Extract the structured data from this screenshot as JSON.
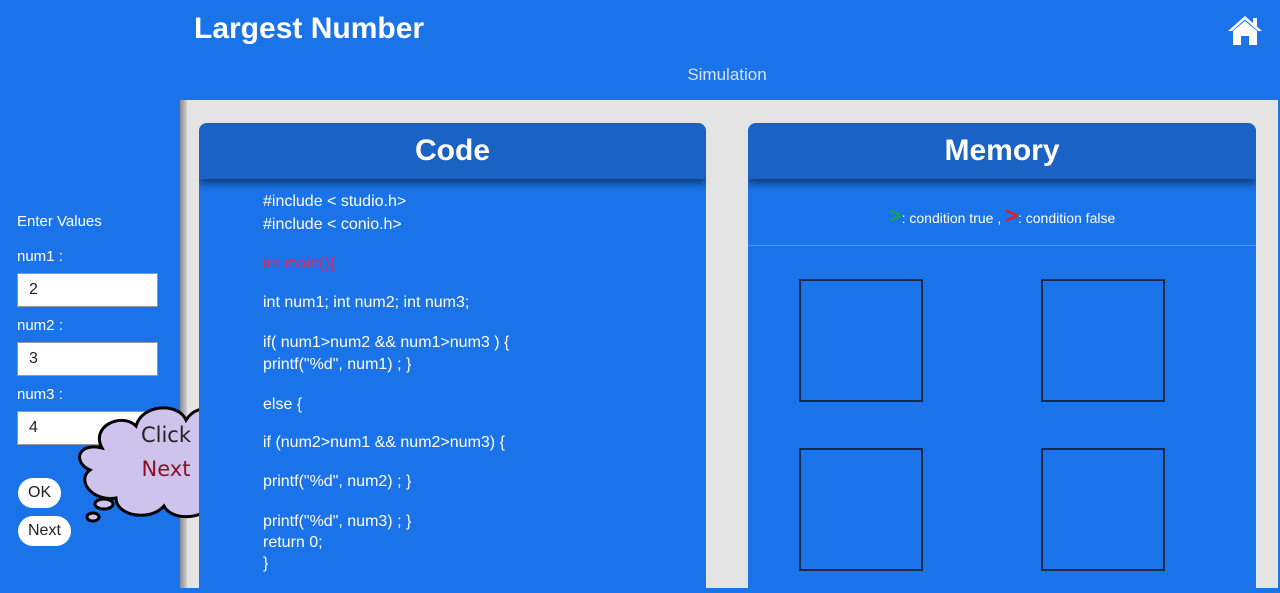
{
  "header": {
    "title": "Largest Number",
    "subtitle": "Simulation",
    "home_icon": "home-icon"
  },
  "sidebar": {
    "heading": "Enter Values",
    "num1_label": "num1 :",
    "num1_value": "2",
    "num2_label": "num2 :",
    "num2_value": "3",
    "num3_label": "num3 :",
    "num3_value": "4",
    "ok_label": "OK",
    "next_label": "Next",
    "hint_line1": "Click",
    "hint_line2": "Next"
  },
  "code_panel": {
    "title": "Code",
    "lines": [
      "#include < studio.h>",
      "#include < conio.h>",
      "int main(){",
      "int num1; int num2; int num3;",
      "if( num1>num2 && num1>num3 ) {",
      "printf(\"%d\", num1) ; }",
      "else {",
      "if (num2>num1 && num2>num3) {",
      "printf(\"%d\", num2) ; }",
      "printf(\"%d\", num3) ; }",
      "return 0;",
      "}"
    ]
  },
  "memory_panel": {
    "title": "Memory",
    "legend_true_symbol": ">",
    "legend_true_text": ": condition true ,",
    "legend_false_symbol": ">",
    "legend_false_text": ": condition false"
  },
  "colors": {
    "background": "#1a73e8",
    "header_panel": "#1a62c4",
    "highlight_code": "#e0245e",
    "true_marker": "#16a34a",
    "false_marker": "#e11d1d",
    "cloud_fill": "#cdc3ec",
    "hint_emphasis": "#8b1026"
  }
}
